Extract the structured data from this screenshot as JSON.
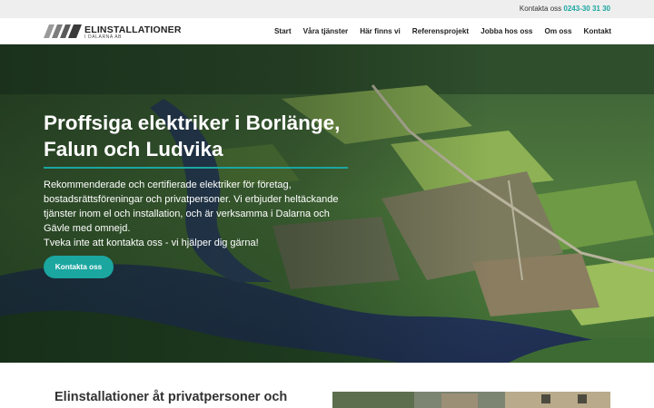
{
  "topbar": {
    "contact_label": "Kontakta oss",
    "phone": "0243-30 31 30"
  },
  "brand": {
    "name": "ELINSTALLATIONER",
    "sub": "I DALARNA AB"
  },
  "nav": {
    "items": [
      {
        "label": "Start"
      },
      {
        "label": "Våra tjänster"
      },
      {
        "label": "Här finns vi"
      },
      {
        "label": "Referensprojekt"
      },
      {
        "label": "Jobba hos oss"
      },
      {
        "label": "Om oss"
      },
      {
        "label": "Kontakt"
      }
    ]
  },
  "hero": {
    "title": "Proffsiga elektriker i Borlänge, Falun och Ludvika",
    "paragraph1": "Rekommenderade och certifierade elektriker för företag, bostadsrättsföreningar och privatpersoner. Vi erbjuder heltäckande tjänster inom el och installation, och är verksamma i Dalarna och Gävle med omnejd.",
    "paragraph2": "Tveka inte att kontakta oss - vi hjälper dig gärna!",
    "button_label": "Kontakta oss"
  },
  "section": {
    "title": "Elinstallationer åt privatpersoner och företag"
  },
  "colors": {
    "accent": "#1ba6a0",
    "topbar_bg": "#eeeeee"
  }
}
